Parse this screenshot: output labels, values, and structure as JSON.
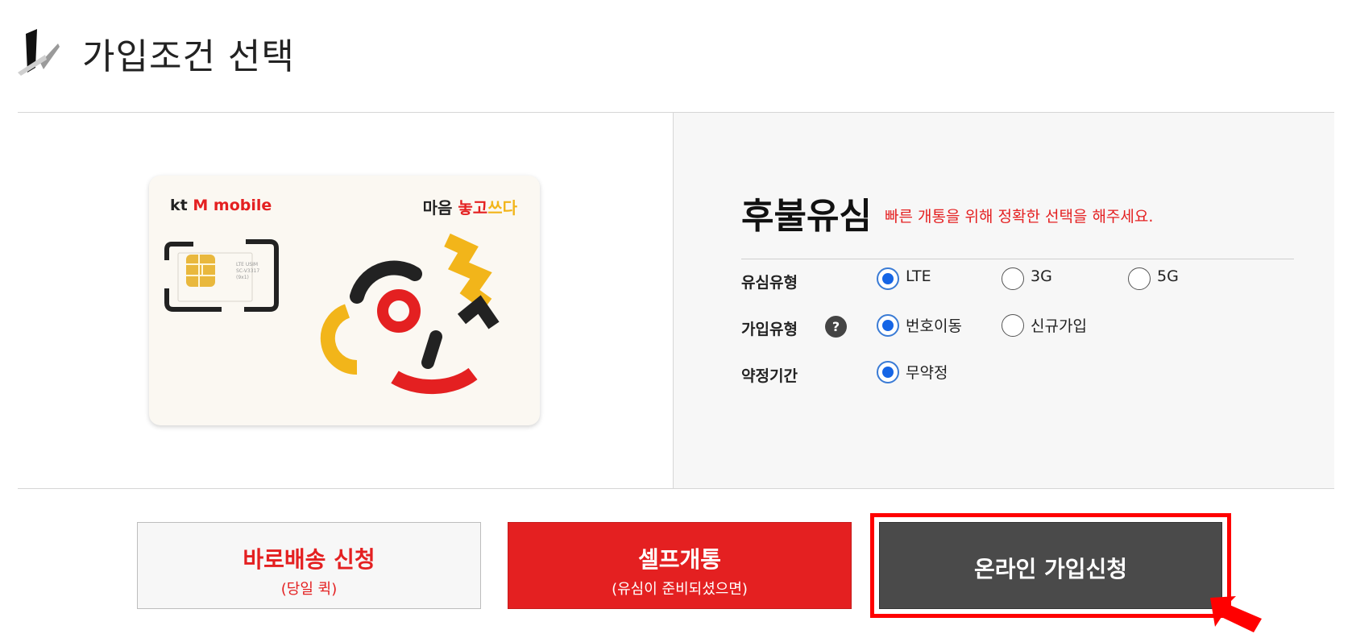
{
  "step": {
    "number": "1",
    "title": "가입조건 선택"
  },
  "sim_card": {
    "brand_kt": "kt",
    "brand_m": "M",
    "brand_mobile": "mobile",
    "slogan_part1": "마음",
    "slogan_part2": "놓고",
    "slogan_part3": "쓰다",
    "chip_text": "LTE USIM SC-V3317 (9x1)"
  },
  "plan": {
    "title": "후불유심",
    "hint": "빠른 개통을 위해 정확한 선택을 해주세요.",
    "rows": [
      {
        "label": "유심유형",
        "options": [
          {
            "label": "LTE",
            "checked": true
          },
          {
            "label": "3G",
            "checked": false
          },
          {
            "label": "5G",
            "checked": false
          }
        ]
      },
      {
        "label": "가입유형",
        "help_icon": "?",
        "options": [
          {
            "label": "번호이동",
            "checked": true
          },
          {
            "label": "신규가입",
            "checked": false
          }
        ]
      },
      {
        "label": "약정기간",
        "options": [
          {
            "label": "무약정",
            "checked": true
          }
        ]
      }
    ]
  },
  "buttons": {
    "quick": {
      "main": "바로배송 신청",
      "sub": "(당일 퀵)"
    },
    "self": {
      "main": "셀프개통",
      "sub": "(유심이 준비되셨으면)"
    },
    "online": {
      "main": "온라인 가입신청"
    }
  },
  "colors": {
    "accent_red": "#e42021",
    "radio_blue": "#1565e6",
    "dark_button": "#4a4a4a",
    "highlight": "#ff0000"
  },
  "icons": [
    "help-icon",
    "pointer-arrow-icon",
    "sim-chip-icon"
  ]
}
